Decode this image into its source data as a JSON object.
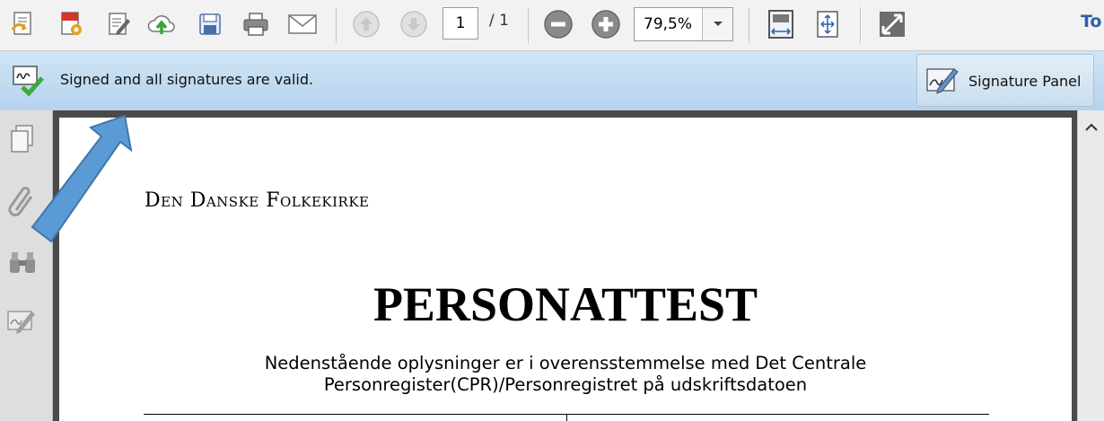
{
  "toolbar": {
    "current_page": "1",
    "page_total": "/ 1",
    "zoom_value": "79,5%",
    "tools_label": "To"
  },
  "signature_bar": {
    "message": "Signed and all signatures are valid.",
    "panel_button_label": "Signature Panel"
  },
  "document": {
    "heading": "Den Danske Folkekirke",
    "title": "PERSONATTEST",
    "subtitle_line1": "Nedenstående oplysninger er i overensstemmelse med Det Centrale",
    "subtitle_line2": "Personregister(CPR)/Personregistret på udskriftsdatoen"
  },
  "colors": {
    "signature_bar_bg": "#c2dcf1",
    "arrow_fill": "#5b9bd5",
    "tools_link": "#2d5fa8"
  },
  "icons": [
    "create-pdf-icon",
    "edit-pdf-icon",
    "fill-sign-icon",
    "cloud-upload-icon",
    "save-icon",
    "print-icon",
    "email-icon",
    "previous-page-icon",
    "next-page-icon",
    "zoom-out-icon",
    "zoom-in-icon",
    "fit-width-icon",
    "fit-page-icon",
    "full-screen-icon",
    "signature-valid-icon",
    "signature-panel-icon",
    "pages-icon",
    "attachments-icon",
    "binoculars-icon",
    "signatures-icon",
    "scroll-up-icon"
  ]
}
